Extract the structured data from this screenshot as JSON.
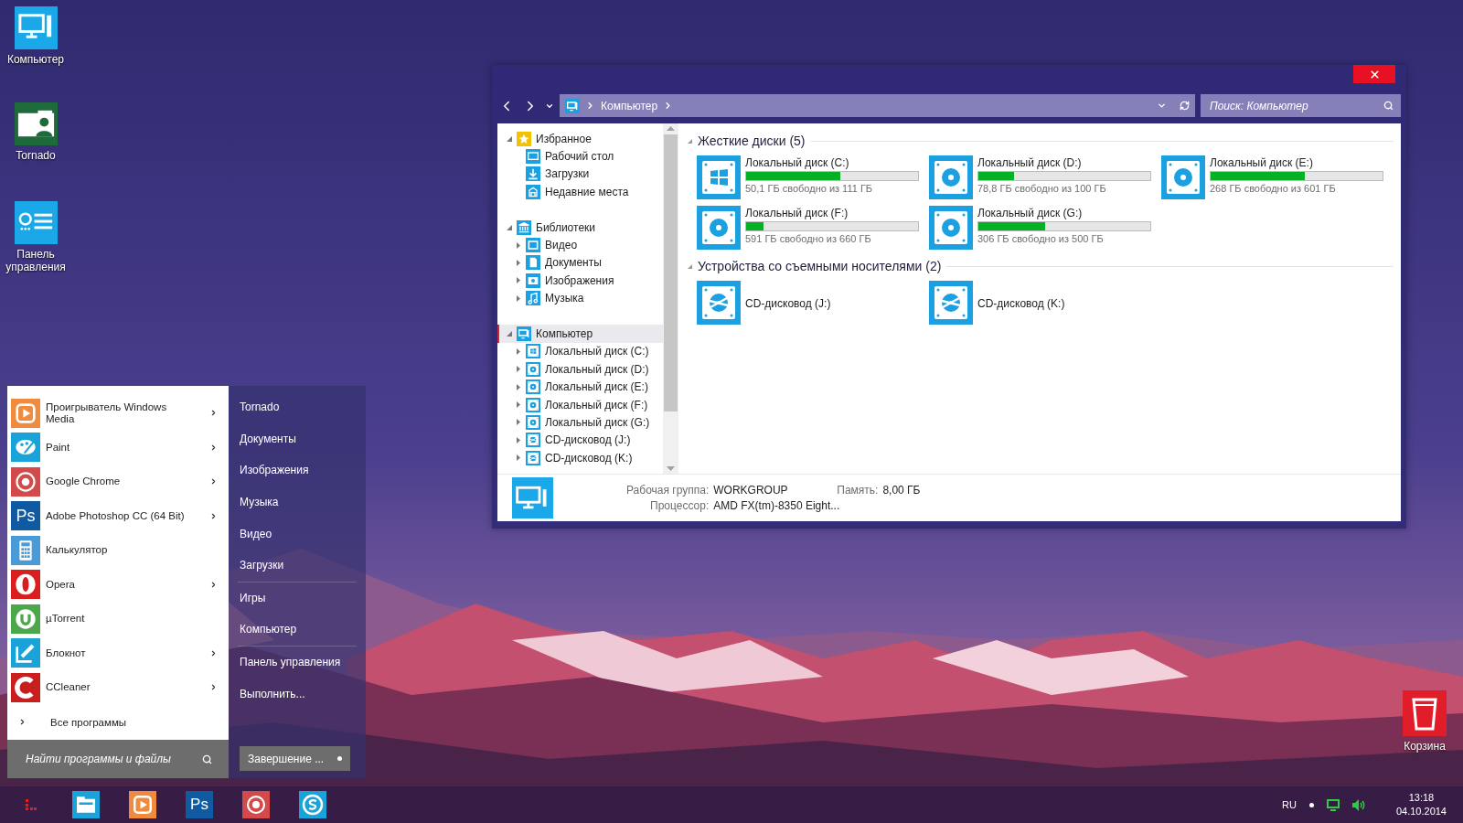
{
  "desktop_icons": [
    {
      "label": "Компьютер",
      "kind": "computer"
    },
    {
      "label": "Tornado",
      "kind": "user-folder"
    },
    {
      "label": "Панель управления",
      "kind": "control-panel"
    }
  ],
  "recycle_bin": {
    "label": "Корзина"
  },
  "explorer": {
    "breadcrumb": [
      "Компьютер"
    ],
    "search": {
      "placeholder": "Поиск: Компьютер"
    },
    "tree": [
      {
        "label": "Избранное",
        "kind": "star",
        "expandable": true,
        "expanded": true,
        "selected": false,
        "children": [
          {
            "label": "Рабочий стол",
            "kind": "desktop",
            "expandable": false,
            "selected": false
          },
          {
            "label": "Загрузки",
            "kind": "download",
            "expandable": false,
            "selected": false
          },
          {
            "label": "Недавние места",
            "kind": "recent",
            "expandable": false,
            "selected": false
          }
        ]
      },
      {
        "label": "Библиотеки",
        "kind": "library",
        "expandable": true,
        "expanded": true,
        "selected": false,
        "children": [
          {
            "label": "Видео",
            "kind": "video",
            "expandable": true,
            "expanded": false,
            "selected": false
          },
          {
            "label": "Документы",
            "kind": "documents",
            "expandable": true,
            "expanded": false,
            "selected": false
          },
          {
            "label": "Изображения",
            "kind": "images",
            "expandable": true,
            "expanded": false,
            "selected": false
          },
          {
            "label": "Музыка",
            "kind": "music",
            "expandable": true,
            "expanded": false,
            "selected": false
          }
        ]
      },
      {
        "label": "Компьютер",
        "kind": "computer",
        "expandable": true,
        "expanded": true,
        "selected": true,
        "children": [
          {
            "label": "Локальный диск (C:)",
            "kind": "system-drive",
            "expandable": true,
            "expanded": false,
            "selected": false
          },
          {
            "label": "Локальный диск (D:)",
            "kind": "disk",
            "expandable": true,
            "expanded": false,
            "selected": false
          },
          {
            "label": "Локальный диск (E:)",
            "kind": "disk",
            "expandable": true,
            "expanded": false,
            "selected": false
          },
          {
            "label": "Локальный диск (F:)",
            "kind": "disk",
            "expandable": true,
            "expanded": false,
            "selected": false
          },
          {
            "label": "Локальный диск (G:)",
            "kind": "disk",
            "expandable": true,
            "expanded": false,
            "selected": false
          },
          {
            "label": "CD-дисковод (J:)",
            "kind": "cd-drive",
            "expandable": true,
            "expanded": false,
            "selected": false
          },
          {
            "label": "CD-дисковод (K:)",
            "kind": "cd-drive",
            "expandable": true,
            "expanded": false,
            "selected": false
          }
        ]
      }
    ],
    "groups": [
      {
        "title": "Жесткие диски (5)",
        "expanded": true,
        "items": [
          {
            "name": "Локальный диск (C:)",
            "kind": "system-drive",
            "level": 0.55,
            "free": "50,1 ГБ свободно из 111 ГБ"
          },
          {
            "name": "Локальный диск (D:)",
            "kind": "disk",
            "level": 0.21,
            "free": "78,8 ГБ свободно из 100 ГБ"
          },
          {
            "name": "Локальный диск (E:)",
            "kind": "disk",
            "level": 0.55,
            "free": "268 ГБ свободно из 601 ГБ"
          },
          {
            "name": "Локальный диск (F:)",
            "kind": "disk",
            "level": 0.1,
            "free": "591 ГБ свободно из 660 ГБ"
          },
          {
            "name": "Локальный диск (G:)",
            "kind": "disk",
            "level": 0.39,
            "free": "306 ГБ свободно из 500 ГБ"
          }
        ]
      },
      {
        "title": "Устройства со съемными носителями (2)",
        "expanded": true,
        "items": [
          {
            "name": "CD-дисковод (J:)",
            "kind": "cd-drive"
          },
          {
            "name": "CD-дисковод (K:)",
            "kind": "cd-drive"
          }
        ]
      }
    ],
    "details": {
      "fields": [
        {
          "label": "Рабочая группа:",
          "value": "WORKGROUP"
        },
        {
          "label": "Память:",
          "value": "8,00 ГБ"
        },
        {
          "label": "Процессор:",
          "value": "AMD FX(tm)-8350 Eight..."
        }
      ]
    }
  },
  "start_menu": {
    "programs": [
      {
        "label": "Проигрыватель Windows Media",
        "kind": "media-player",
        "submenu": true
      },
      {
        "label": "Paint",
        "kind": "paint",
        "submenu": true
      },
      {
        "label": "Google Chrome",
        "kind": "chrome",
        "submenu": true
      },
      {
        "label": "Adobe Photoshop CC (64 Bit)",
        "kind": "photoshop",
        "icon_text": "Ps",
        "submenu": true
      },
      {
        "label": "Калькулятор",
        "kind": "calculator",
        "submenu": false
      },
      {
        "label": "Opera",
        "kind": "opera",
        "submenu": true
      },
      {
        "label": "µTorrent",
        "kind": "utorrent",
        "submenu": false
      },
      {
        "label": "Блокнот",
        "kind": "notepad",
        "submenu": true
      },
      {
        "label": "CCleaner",
        "kind": "ccleaner",
        "submenu": true
      }
    ],
    "all_programs": "Все программы",
    "search": {
      "placeholder": "Найти программы и файлы"
    },
    "places": [
      {
        "label": "Tornado",
        "divider_before": false
      },
      {
        "label": "Документы",
        "divider_before": false
      },
      {
        "label": "Изображения",
        "divider_before": false
      },
      {
        "label": "Музыка",
        "divider_before": false
      },
      {
        "label": "Видео",
        "divider_before": false
      },
      {
        "label": "Загрузки",
        "divider_before": false
      },
      {
        "label": "Игры",
        "divider_before": true
      },
      {
        "label": "Компьютер",
        "divider_before": false
      },
      {
        "label": "Панель управления",
        "divider_before": true
      },
      {
        "label": "Выполнить...",
        "divider_before": false
      }
    ],
    "shutdown": {
      "label": "Завершение ..."
    }
  },
  "taskbar": {
    "apps": [
      {
        "kind": "file-explorer"
      },
      {
        "kind": "media-player"
      },
      {
        "kind": "photoshop",
        "icon_text": "Ps"
      },
      {
        "kind": "chrome"
      },
      {
        "kind": "skype"
      }
    ],
    "language": "RU",
    "time": "13:18",
    "date": "04.10.2014"
  }
}
